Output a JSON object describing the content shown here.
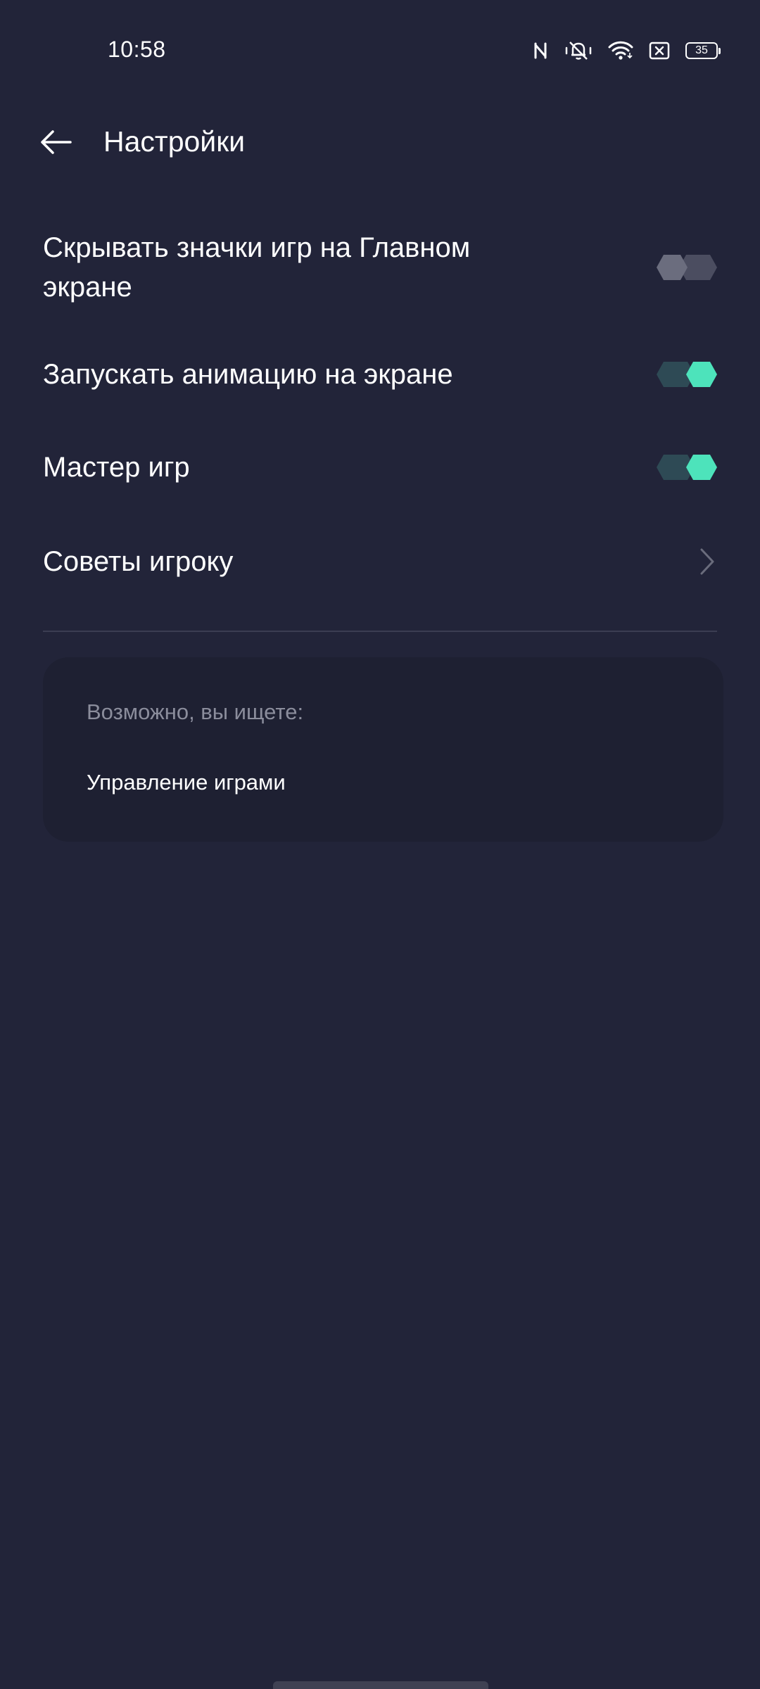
{
  "status_bar": {
    "time": "10:58",
    "battery_level": "35",
    "icons": [
      "nfc-icon",
      "silent-bell-icon",
      "wifi-icon",
      "no-sim-icon",
      "battery-icon"
    ]
  },
  "header": {
    "title": "Настройки",
    "back_icon": "arrow-left-icon"
  },
  "settings": [
    {
      "label": "Скрывать значки игр на Главном экране",
      "control": "toggle",
      "on": false
    },
    {
      "label": "Запускать анимацию на экране",
      "control": "toggle",
      "on": true
    },
    {
      "label": "Мастер игр",
      "control": "toggle",
      "on": true
    },
    {
      "label": "Советы игроку",
      "control": "chevron",
      "icon": "chevron-right-icon"
    }
  ],
  "suggestions": {
    "heading": "Возможно, вы ищете:",
    "items": [
      "Управление играми"
    ]
  },
  "colors": {
    "background": "#222439",
    "card": "#1e2032",
    "accent": "#4de3bb",
    "toggle_track_on": "#2e4a55",
    "toggle_off": "#4b4d60",
    "secondary_text": "#8b8d9c"
  }
}
